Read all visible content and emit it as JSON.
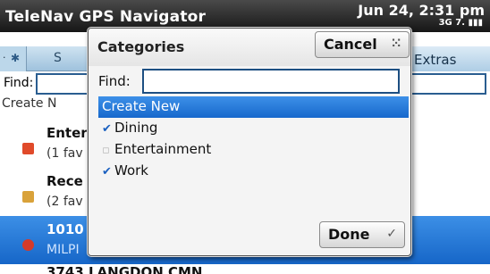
{
  "app": {
    "title": "TeleNav GPS Navigator",
    "status_date": "Jun 24, 2:31 pm",
    "status_network": "3G 7. ▮▮▮",
    "tabs": [
      {
        "label": "·"
      },
      {
        "label": "S"
      },
      {
        "label": "Extras"
      }
    ],
    "find_label": "Find:",
    "create_new_partial": "Create N",
    "list": [
      {
        "title": "Enter",
        "sub": "(1 fav",
        "icon": "favorites-icon",
        "icon_color": "#e04a2a"
      },
      {
        "title": "Rece",
        "sub": "(2 fav",
        "icon": "recent-folder-icon",
        "icon_color": "#d9a23a"
      },
      {
        "title": "1010",
        "sub": "MILPI",
        "icon": "pin-icon",
        "icon_color": "#d43a2a",
        "selected": true
      }
    ],
    "cut_row": "3743 LANGDON CMN"
  },
  "dialog": {
    "title": "Categories",
    "cancel_label": "Cancel",
    "cancel_icon": "⁙",
    "done_label": "Done",
    "done_icon": "✓",
    "find_label": "Find:",
    "find_value": "",
    "find_placeholder": "",
    "categories": [
      {
        "label": "Create New",
        "checked": null,
        "highlighted": true
      },
      {
        "label": "Dining",
        "checked": true
      },
      {
        "label": "Entertainment",
        "checked": false
      },
      {
        "label": "Work",
        "checked": true
      }
    ]
  },
  "colors": {
    "highlight": "#1768cc",
    "titlebar": "#161616",
    "tabbar": "#9fc2dd"
  }
}
